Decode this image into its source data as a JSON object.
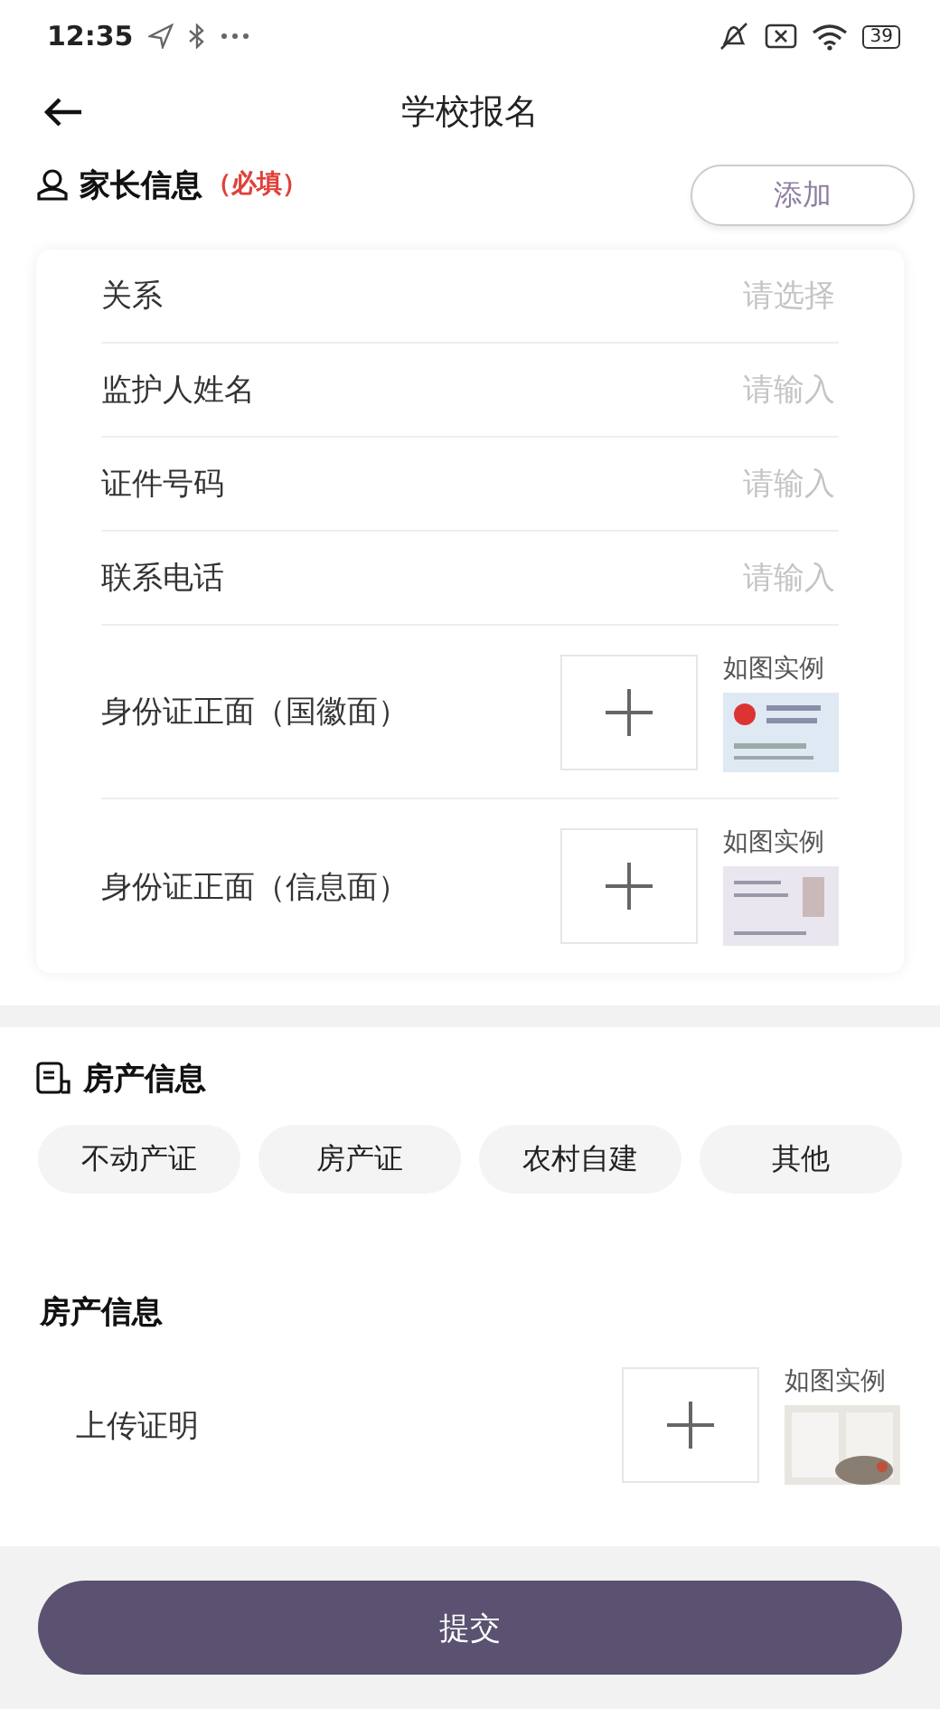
{
  "status_bar": {
    "time": "12:35",
    "battery": "39"
  },
  "nav": {
    "title": "学校报名"
  },
  "parent_section": {
    "title": "家长信息",
    "required_note": "（必填）",
    "add_button": "添加",
    "rows": [
      {
        "kind": "field",
        "label": "关系",
        "placeholder": "请选择"
      },
      {
        "kind": "field",
        "label": "监护人姓名",
        "placeholder": "请输入"
      },
      {
        "kind": "field",
        "label": "证件号码",
        "placeholder": "请输入"
      },
      {
        "kind": "field",
        "label": "联系电话",
        "placeholder": "请输入"
      },
      {
        "kind": "upload",
        "label": "身份证正面（国徽面）",
        "example_label": "如图实例"
      },
      {
        "kind": "upload",
        "label": "身份证正面（信息面）",
        "example_label": "如图实例"
      }
    ]
  },
  "property_section": {
    "title": "房产信息",
    "options": [
      {
        "label": "不动产证",
        "selected": false
      },
      {
        "label": "房产证",
        "selected": false
      },
      {
        "label": "农村自建",
        "selected": false
      },
      {
        "label": "其他",
        "selected": false
      }
    ],
    "subtitle": "房产信息",
    "upload": {
      "label": "上传证明",
      "example_label": "如图实例"
    }
  },
  "submit_button": "提交"
}
